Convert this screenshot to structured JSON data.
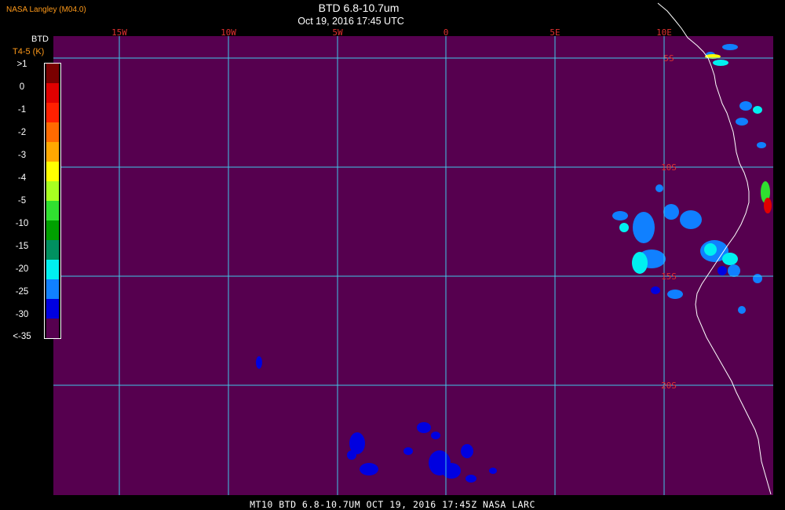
{
  "corner_label": "NASA Langley (M04.0)",
  "title": "BTD 6.8-10.7um",
  "subtitle": "Oct 19, 2016 17:45 UTC",
  "footer": "MT10  BTD 6.8-10.7UM  OCT 19, 2016 17:45Z  NASA LARC",
  "colorbar": {
    "title": "BTD",
    "units": "T4-5 (K)",
    "labels": [
      ">1",
      "0",
      "-1",
      "-2",
      "-3",
      "-4",
      "-5",
      "-10",
      "-15",
      "-20",
      "-25",
      "-30",
      "<-35"
    ],
    "colors": [
      "#7a0000",
      "#e00000",
      "#ff2000",
      "#ff6a00",
      "#ffa800",
      "#ffff00",
      "#a8ff20",
      "#30e030",
      "#00a000",
      "#009060",
      "#00f0f0",
      "#1080ff",
      "#0000e0",
      "#56004f"
    ]
  },
  "map": {
    "background_color": "#56004f",
    "grid_color": "#40c8e8",
    "coast_color": "#ffffff",
    "lon_labels": [
      "15W",
      "10W",
      "5W",
      "0",
      "5E",
      "10E"
    ],
    "lat_labels": [
      "5S",
      "10S",
      "15S",
      "20S"
    ],
    "label_color": "#e03030"
  }
}
